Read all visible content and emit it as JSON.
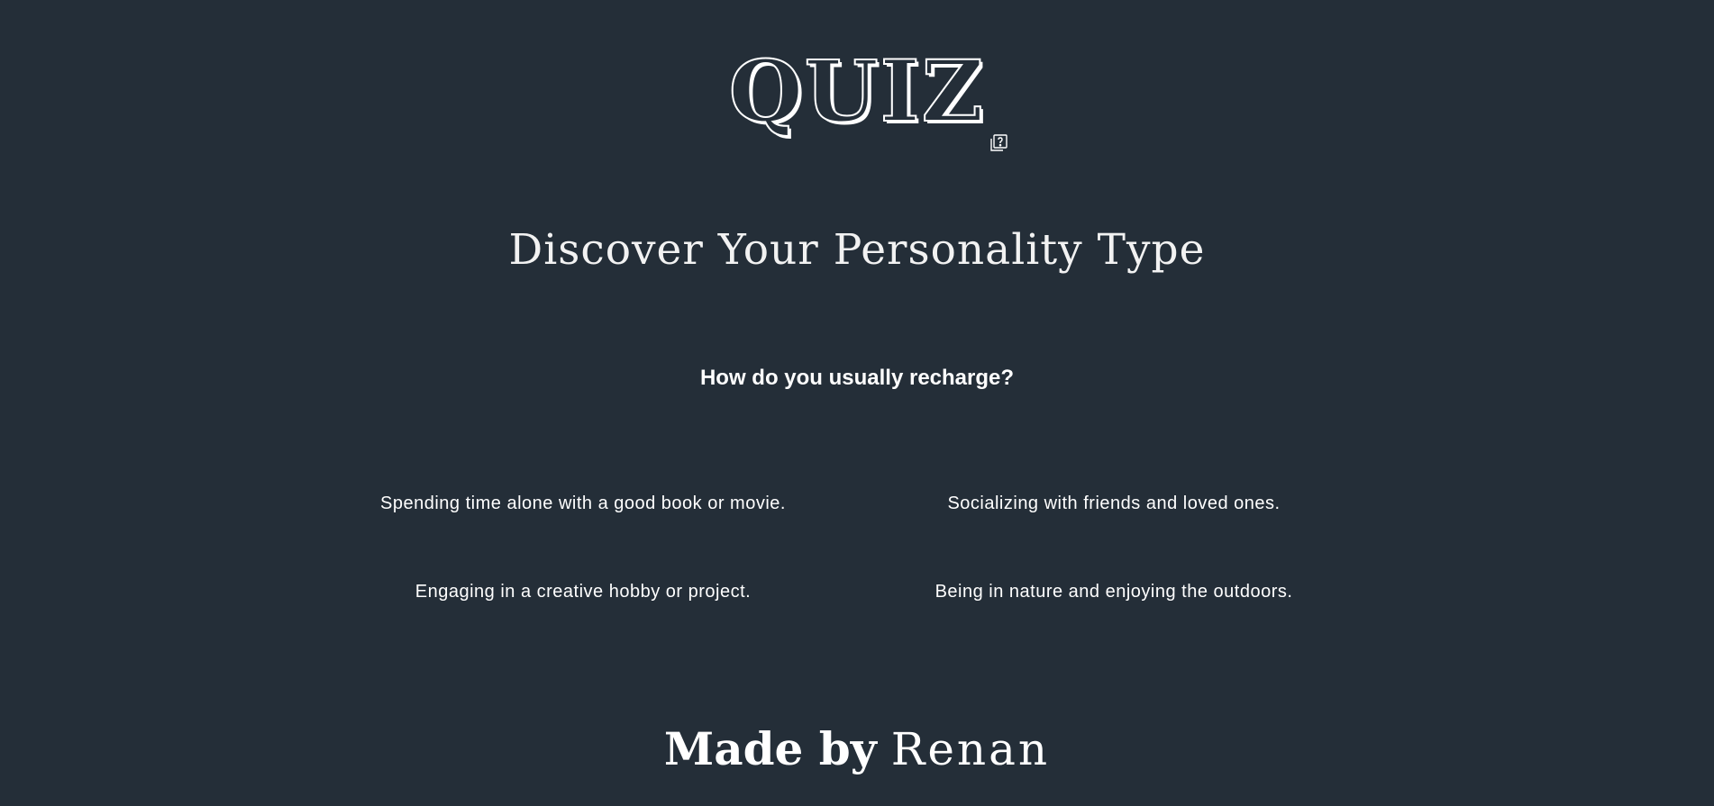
{
  "header": {
    "logo_text": "QUIZ",
    "logo_icon": "question-cards-icon"
  },
  "main": {
    "title": "Discover Your Personality Type",
    "question": "How do you usually recharge?",
    "answers": [
      "Spending time alone with a good book or movie.",
      "Socializing with friends and loved ones.",
      "Engaging in a creative hobby or project.",
      "Being in nature and enjoying the outdoors."
    ]
  },
  "footer": {
    "made_by": "Made by",
    "author": "Renan"
  },
  "colors": {
    "background": "#242e38",
    "text": "#ffffff"
  }
}
